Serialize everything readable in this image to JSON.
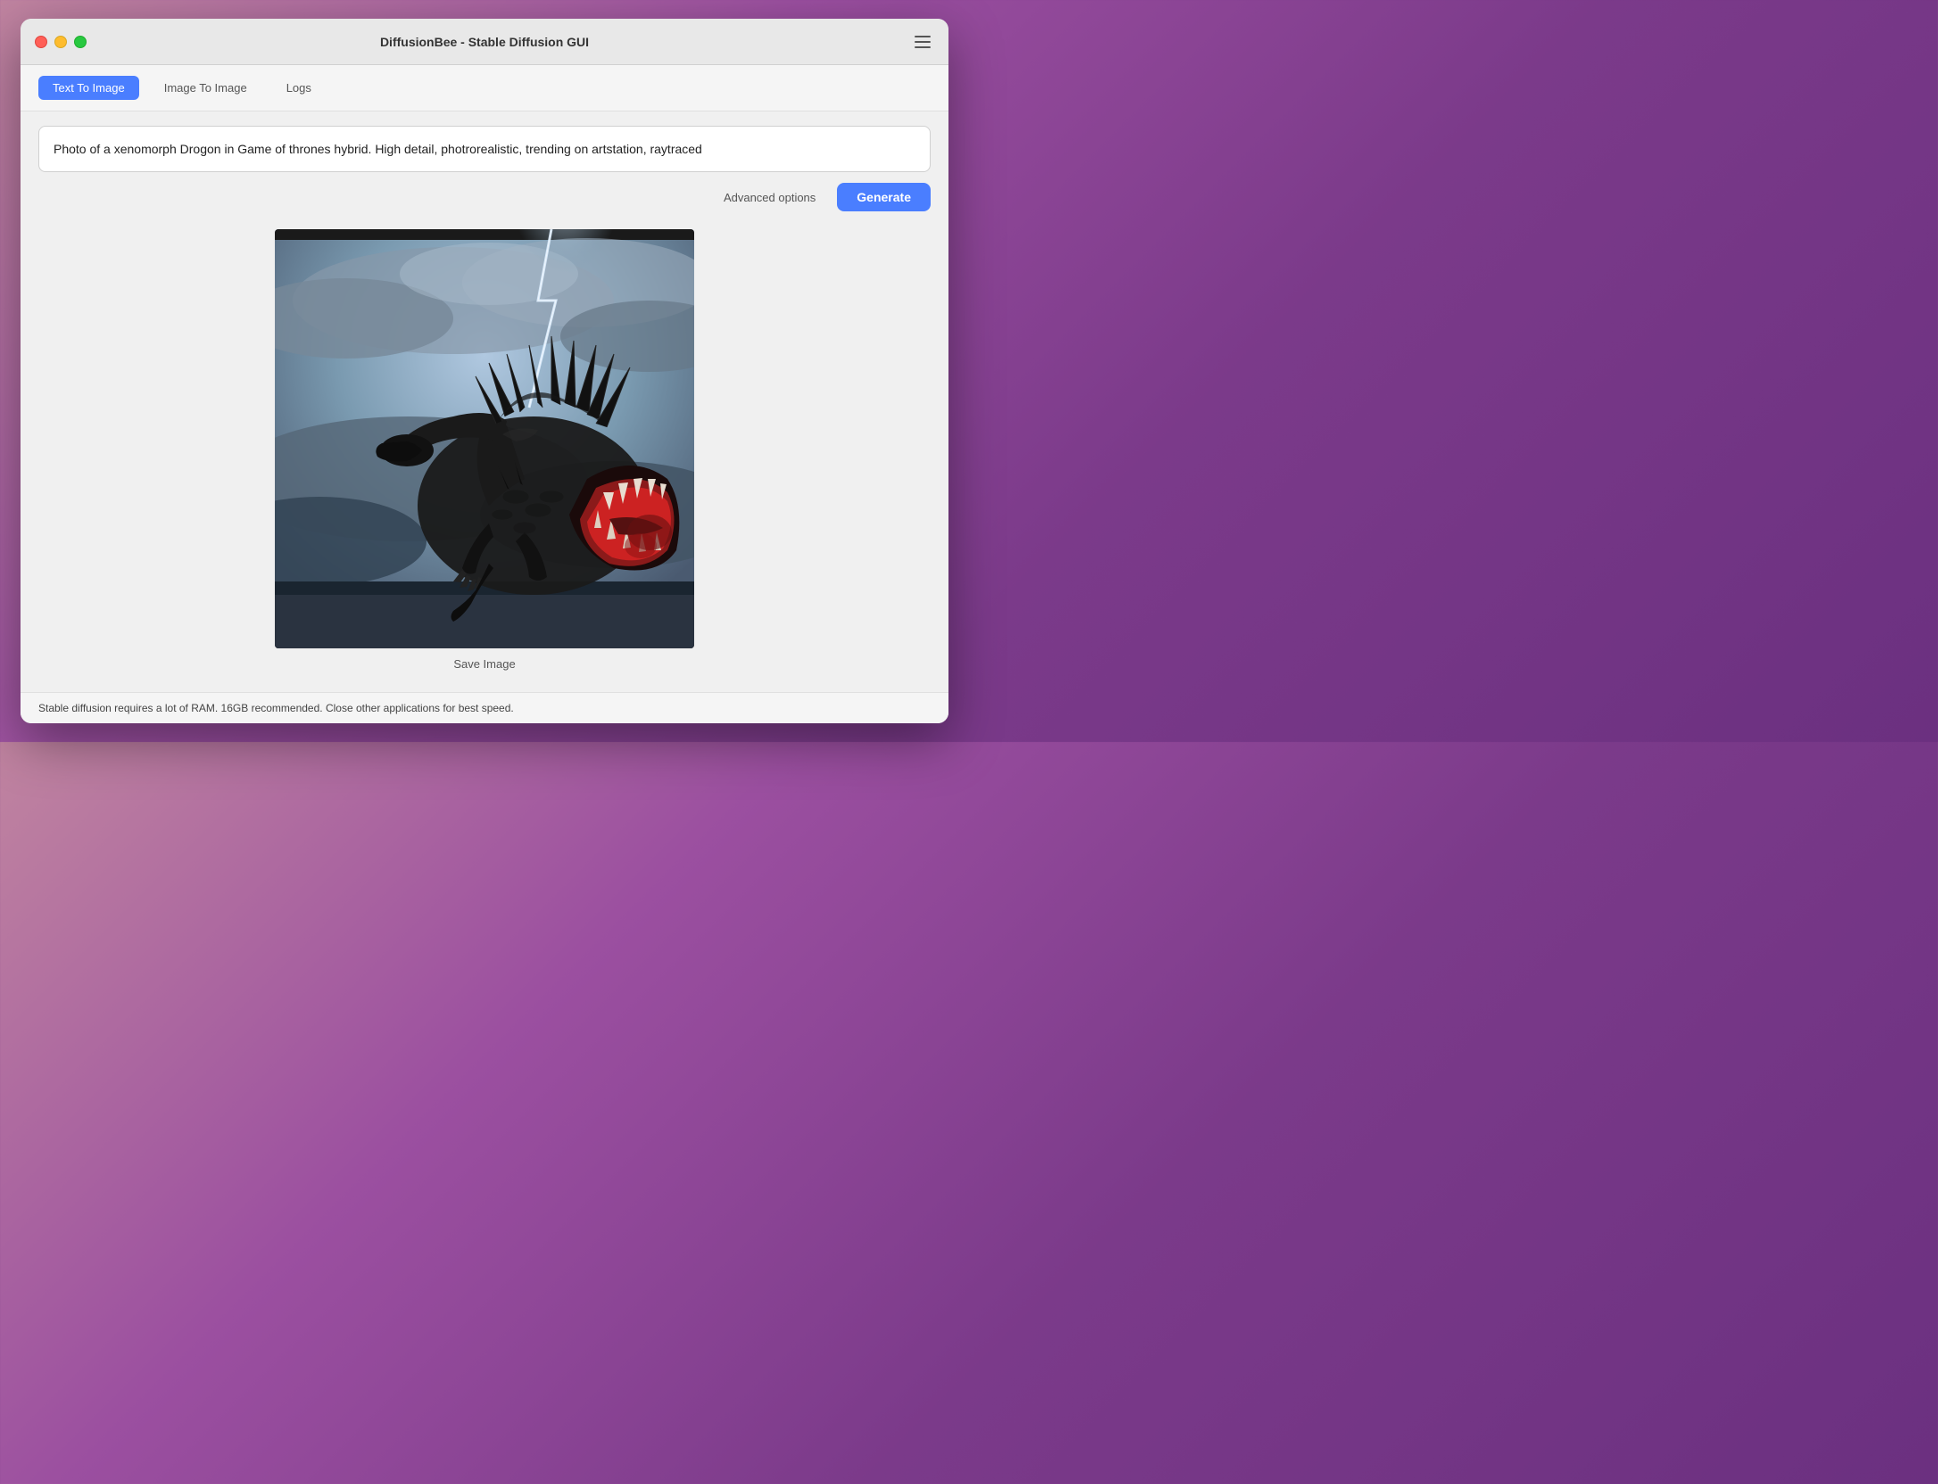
{
  "window": {
    "title": "DiffusionBee - Stable Diffusion GUI"
  },
  "tabs": [
    {
      "id": "text-to-image",
      "label": "Text To Image",
      "active": true
    },
    {
      "id": "image-to-image",
      "label": "Image To Image",
      "active": false
    },
    {
      "id": "logs",
      "label": "Logs",
      "active": false
    }
  ],
  "prompt": {
    "value": "Photo of a xenomorph Drogon in Game of thrones hybrid. High detail, photrorealistic, trending on artstation, raytraced"
  },
  "toolbar": {
    "advanced_options_label": "Advanced options",
    "generate_label": "Generate"
  },
  "image": {
    "save_label": "Save Image",
    "alt": "AI generated image of xenomorph dragon hybrid"
  },
  "status": {
    "message": "Stable diffusion requires a lot of RAM. 16GB recommended. Close other applications for best speed."
  },
  "colors": {
    "active_tab": "#4a7eff",
    "generate_button": "#4a7eff"
  }
}
